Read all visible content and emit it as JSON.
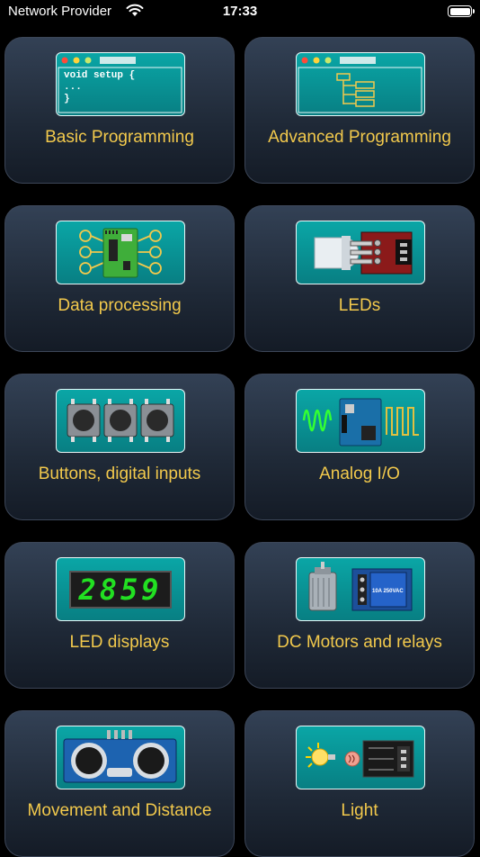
{
  "status_bar": {
    "carrier": "Network Provider",
    "time": "17:33",
    "icons": [
      "wifi-icon",
      "battery-icon"
    ]
  },
  "colors": {
    "background": "#000000",
    "card": "#263244",
    "label": "#f2c94c",
    "icon_teal": "#0a9a9c"
  },
  "categories": [
    {
      "label": "Basic Programming",
      "icon": "code-window-icon",
      "code_lines": [
        "void setup {",
        "...",
        "}"
      ]
    },
    {
      "label": "Advanced Programming",
      "icon": "flowchart-window-icon"
    },
    {
      "label": "Data processing",
      "icon": "circuit-board-icon"
    },
    {
      "label": "LEDs",
      "icon": "led-module-icon"
    },
    {
      "label": "Buttons, digital inputs",
      "icon": "push-buttons-icon"
    },
    {
      "label": "Analog I/O",
      "icon": "analog-signals-icon"
    },
    {
      "label": "LED displays",
      "icon": "seven-segment-display-icon",
      "display_text": "2859"
    },
    {
      "label": "DC Motors and relays",
      "icon": "motor-relay-icon",
      "relay_text": "10A 250VAC"
    },
    {
      "label": "Movement and Distance",
      "icon": "ultrasonic-sensor-icon"
    },
    {
      "label": "Light",
      "icon": "light-sensor-icon"
    }
  ]
}
